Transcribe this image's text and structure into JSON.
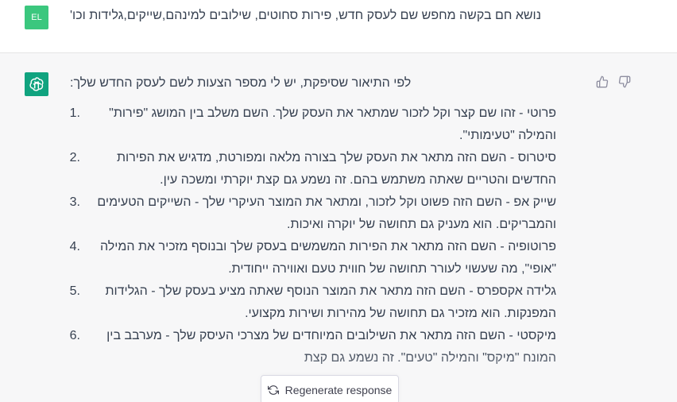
{
  "user_message": {
    "avatar_initials": "EL",
    "text": "נושא חם בקשה מחפש שם לעסק חדש, פירות סחוטים, שילובים למינהם,שייקים,גלידות וכו'"
  },
  "assistant_message": {
    "intro": "לפי התיאור שסיפקת, יש לי מספר הצעות לשם לעסק החדש שלך:",
    "items": [
      {
        "number": "1.",
        "text": "פרוטי - זהו שם קצר וקל לזכור שמתאר את העסק שלך. השם משלב בין המושג \"פירות\" והמילה \"טעימותי\"."
      },
      {
        "number": "2.",
        "text": "סיטרוס - השם הזה מתאר את העסק שלך בצורה מלאה ומפורטת, מדגיש את הפירות החדשים והטריים שאתה משתמש בהם. זה נשמע גם קצת יוקרתי ומשכה עין."
      },
      {
        "number": "3.",
        "text": "שייק אפ - השם הזה פשוט וקל לזכור, ומתאר את המוצר העיקרי שלך - השייקים הטעימים והמבריקים. הוא מעניק גם תחושה של יוקרה ואיכות."
      },
      {
        "number": "4.",
        "text": "פרוטופיה - השם הזה מתאר את הפירות המשמשים בעסק שלך ובנוסף מזכיר את המילה \"אופי\", מה שעשוי לעורר תחושה של חווית טעם ואווירה ייחודית."
      },
      {
        "number": "5.",
        "text": "גלידה אקספרס - השם הזה מתאר את המוצר הנוסף שאתה מציע בעסק שלך - הגלידות המפנקות. הוא מזכיר גם תחושה של מהירות ושירות מקצועי."
      },
      {
        "number": "6.",
        "text": "מיקסטי - השם הזה מתאר את השילובים המיוחדים של מצרכי העיסק שלך - מערבב בין המונח \"מיקס\" והמילה \"טעים\". זה נשמע גם קצת"
      }
    ]
  },
  "regenerate_button": {
    "label": "Regenerate response"
  },
  "colors": {
    "user_avatar": "#3bc77e",
    "bot_avatar": "#10a37f",
    "assistant_bg": "#f7f7f8"
  }
}
